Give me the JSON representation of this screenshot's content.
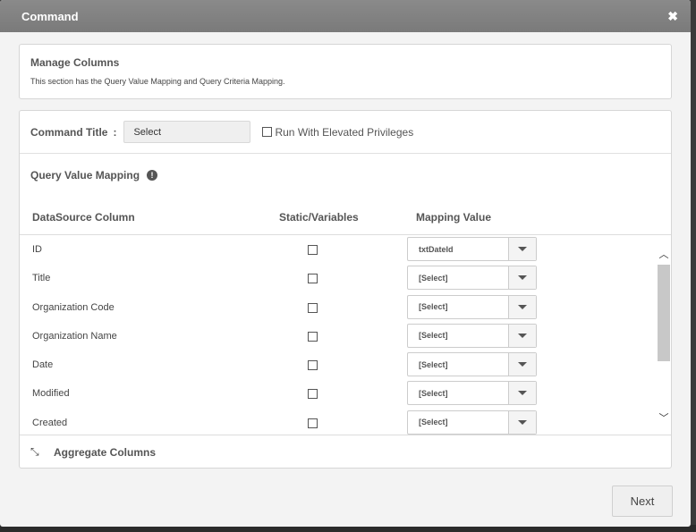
{
  "modal": {
    "title": "Command",
    "close_icon": "close-icon"
  },
  "manage": {
    "title": "Manage Columns",
    "description": "This section has the Query Value Mapping and Query Criteria Mapping."
  },
  "command": {
    "label": "Command Title",
    "colon": ":",
    "select_value": "Select",
    "elevated_label": "Run With Elevated Privileges"
  },
  "query_value_mapping": {
    "title": "Query Value Mapping",
    "info_icon": "info-icon",
    "headers": {
      "column": "DataSource Column",
      "static": "Static/Variables",
      "mapping": "Mapping Value"
    },
    "rows": [
      {
        "label": "ID",
        "value": "txtDateId"
      },
      {
        "label": "Title",
        "value": "[Select]"
      },
      {
        "label": "Organization Code",
        "value": "[Select]"
      },
      {
        "label": "Organization Name",
        "value": "[Select]"
      },
      {
        "label": "Date",
        "value": "[Select]"
      },
      {
        "label": "Modified",
        "value": "[Select]"
      },
      {
        "label": "Created",
        "value": "[Select]"
      }
    ]
  },
  "aggregate": {
    "label": "Aggregate Columns",
    "icon": "collapse-arrows-icon"
  },
  "footer": {
    "next_label": "Next"
  }
}
